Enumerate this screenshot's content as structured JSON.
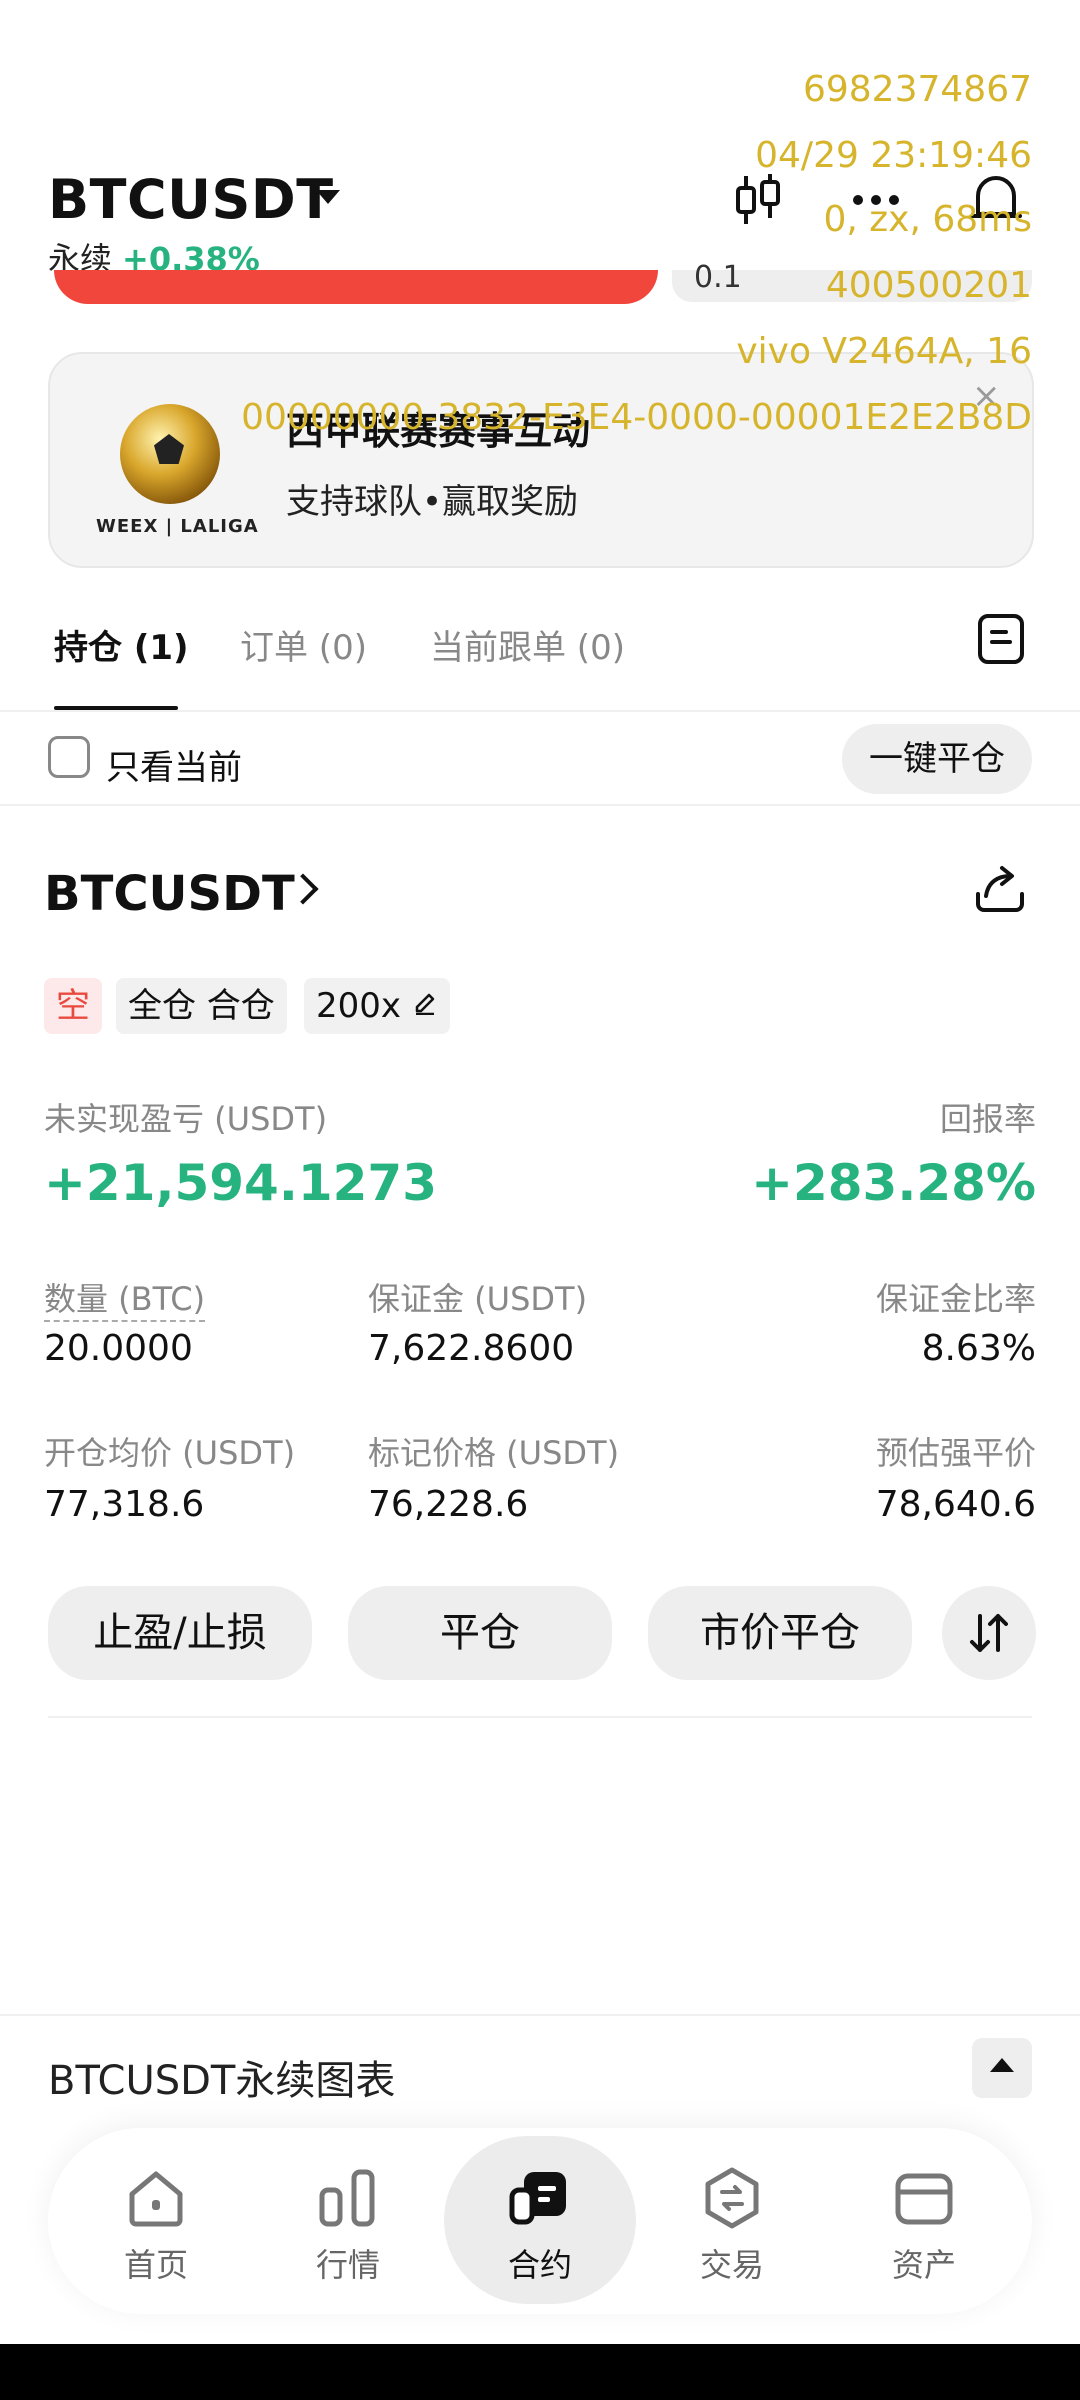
{
  "header": {
    "symbol": "BTCUSDT",
    "contract_type": "永续",
    "change_pct": "+0.38%",
    "partial_value": "0.1",
    "icons": [
      "candlestick-icon",
      "more-icon",
      "bell-icon"
    ]
  },
  "debug_overlay": {
    "lines": [
      "6982374867",
      "04/29 23:19:46",
      "0, zx, 68ms",
      "400500201",
      "vivo V2464A, 16",
      "00000000-3832-E3E4-0000-00001E2E2B8D"
    ]
  },
  "banner": {
    "title": "西甲联赛赛事互动",
    "subtitle": "支持球队•赢取奖励",
    "brand": "WEEX | LALIGA",
    "close_glyph": "×"
  },
  "tabs": [
    {
      "label": "持仓 (1)",
      "active": true
    },
    {
      "label": "订单 (0)",
      "active": false
    },
    {
      "label": "当前跟单 (0)",
      "active": false
    }
  ],
  "filter": {
    "only_current_label": "只看当前",
    "close_all_label": "一键平仓"
  },
  "position": {
    "symbol": "BTCUSDT",
    "side_tag": "空",
    "margin_mode_tag": "全仓 合仓",
    "leverage_tag": "200x",
    "pnl_label": "未实现盈亏 (USDT)",
    "pnl_value": "+21,594.1273",
    "roe_label": "回报率",
    "roe_value": "+283.28%",
    "qty_label": "数量 (BTC)",
    "qty_value": "20.0000",
    "margin_label": "保证金 (USDT)",
    "margin_value": "7,622.8600",
    "margin_ratio_label": "保证金比率",
    "margin_ratio_value": "8.63%",
    "entry_label": "开仓均价 (USDT)",
    "entry_value": "77,318.6",
    "mark_label": "标记价格 (USDT)",
    "mark_value": "76,228.6",
    "liq_label": "预估强平价",
    "liq_value": "78,640.6"
  },
  "actions": {
    "tpsl": "止盈/止损",
    "close": "平仓",
    "market_close": "市价平仓"
  },
  "chart_section": {
    "title": "BTCUSDT永续图表"
  },
  "bottom_nav": [
    {
      "label": "首页",
      "icon": "home-icon",
      "active": false
    },
    {
      "label": "行情",
      "icon": "market-icon",
      "active": false
    },
    {
      "label": "合约",
      "icon": "futures-icon",
      "active": true
    },
    {
      "label": "交易",
      "icon": "trade-icon",
      "active": false
    },
    {
      "label": "资产",
      "icon": "wallet-icon",
      "active": false
    }
  ],
  "colors": {
    "positive": "#26b37f",
    "negative": "#f0463c",
    "overlay": "#d6b42c"
  }
}
